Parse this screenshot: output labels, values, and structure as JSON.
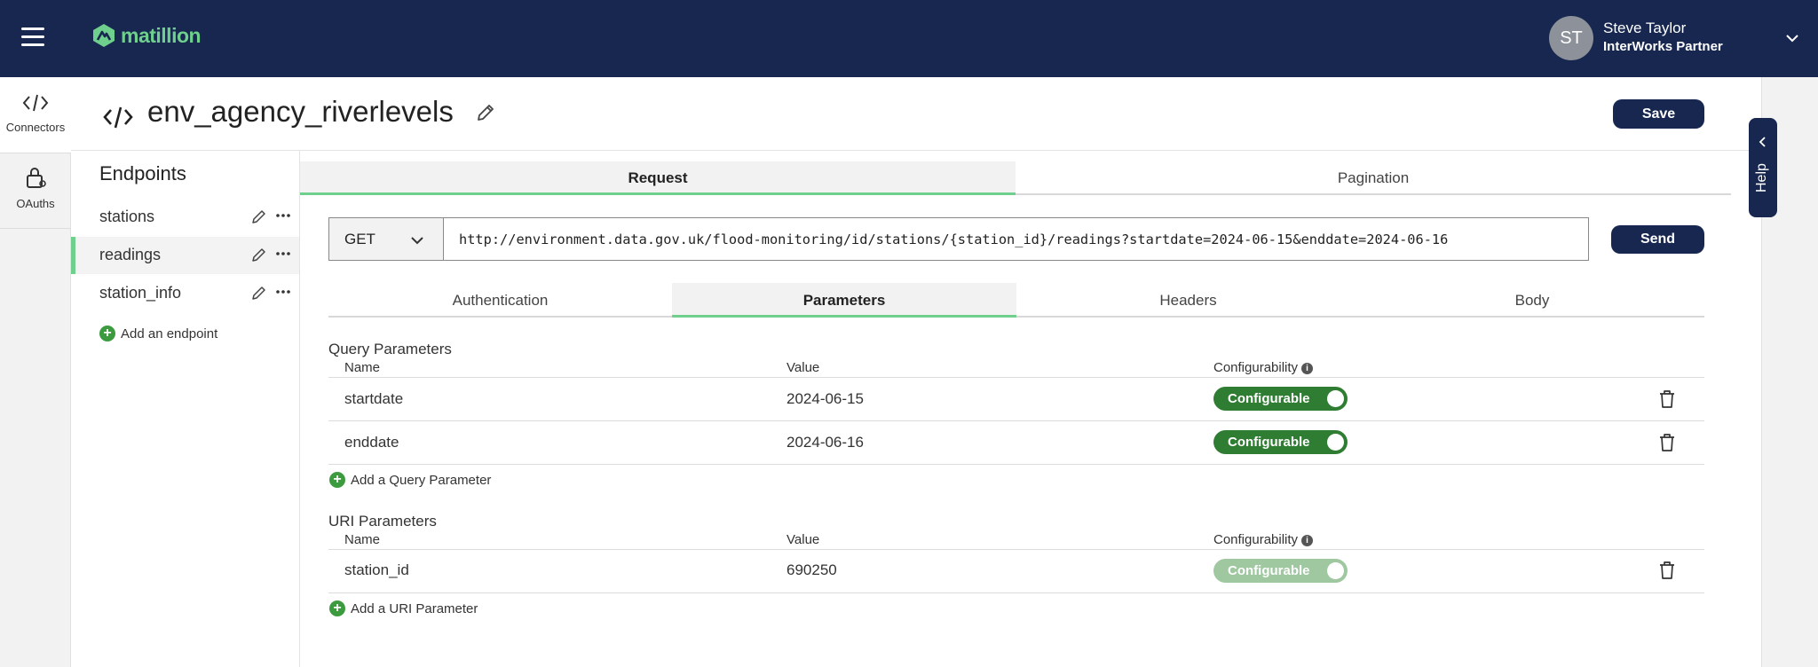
{
  "brand": {
    "name": "matillion",
    "accent": "#6fd08e",
    "nav_bg": "#17274f"
  },
  "user": {
    "initials": "ST",
    "name": "Steve Taylor",
    "org": "InterWorks Partner"
  },
  "rail": [
    {
      "label": "Connectors",
      "icon": "code-icon"
    },
    {
      "label": "OAuths",
      "icon": "lock-icon"
    }
  ],
  "page": {
    "title": "env_agency_riverlevels",
    "save_label": "Save"
  },
  "endpoints": {
    "heading": "Endpoints",
    "items": [
      {
        "name": "stations",
        "active": false
      },
      {
        "name": "readings",
        "active": true
      },
      {
        "name": "station_info",
        "active": false
      }
    ],
    "add_label": "Add an endpoint"
  },
  "tabs_top": [
    {
      "label": "Request",
      "active": true
    },
    {
      "label": "Pagination",
      "active": false
    }
  ],
  "request": {
    "method": "GET",
    "url": "http://environment.data.gov.uk/flood-monitoring/id/stations/{station_id}/readings?startdate=2024-06-15&enddate=2024-06-16",
    "send_label": "Send"
  },
  "tabs_sub": [
    {
      "label": "Authentication",
      "active": false
    },
    {
      "label": "Parameters",
      "active": true
    },
    {
      "label": "Headers",
      "active": false
    },
    {
      "label": "Body",
      "active": false
    }
  ],
  "query_params": {
    "title": "Query Parameters",
    "col_name": "Name",
    "col_value": "Value",
    "col_config": "Configurability",
    "rows": [
      {
        "name": "startdate",
        "value": "2024-06-15",
        "toggle": "Configurable",
        "enabled": true
      },
      {
        "name": "enddate",
        "value": "2024-06-16",
        "toggle": "Configurable",
        "enabled": true
      }
    ],
    "add_label": "Add a Query Parameter"
  },
  "uri_params": {
    "title": "URI Parameters",
    "col_name": "Name",
    "col_value": "Value",
    "col_config": "Configurability",
    "rows": [
      {
        "name": "station_id",
        "value": "690250",
        "toggle": "Configurable",
        "enabled": false
      }
    ],
    "add_label": "Add a URI Parameter"
  },
  "help": {
    "label": "Help"
  }
}
